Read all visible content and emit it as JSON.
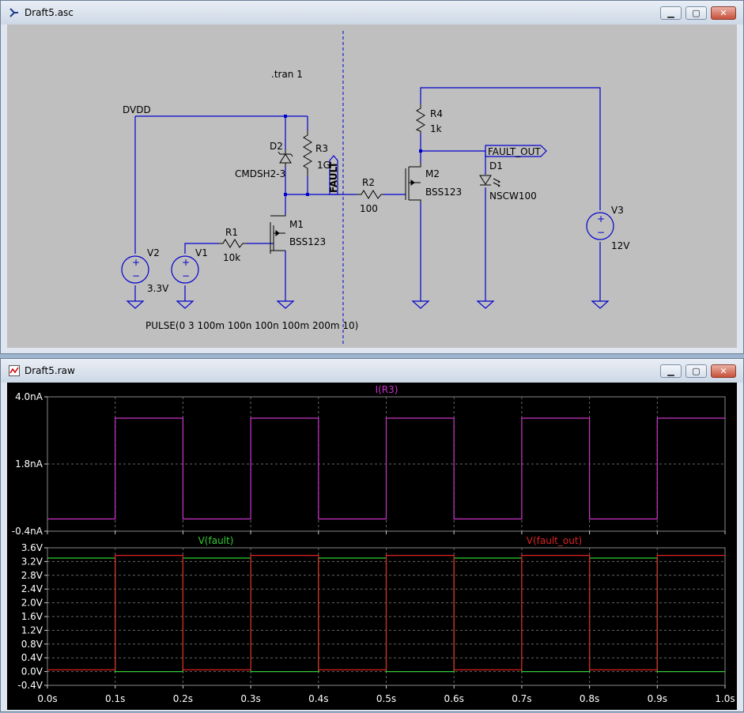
{
  "schematic_window": {
    "title": "Draft5.asc",
    "directive": ".tran 1",
    "net_dvdd": "DVDD",
    "net_fault": "FAULT",
    "net_fault_out": "FAULT_OUT",
    "pulse_spec": "PULSE(0 3 100m 100n 100n 100m 200m 10)",
    "components": {
      "D2": {
        "name": "D2",
        "value": "CMDSH2-3"
      },
      "R3": {
        "name": "R3",
        "value": "1G"
      },
      "R2": {
        "name": "R2",
        "value": "100"
      },
      "R4": {
        "name": "R4",
        "value": "1k"
      },
      "M2": {
        "name": "M2",
        "value": "BSS123"
      },
      "D1": {
        "name": "D1",
        "value": "NSCW100"
      },
      "M1": {
        "name": "M1",
        "value": "BSS123"
      },
      "R1": {
        "name": "R1",
        "value": "10k"
      },
      "V1": {
        "name": "V1",
        "value": ""
      },
      "V2": {
        "name": "V2",
        "value": "3.3V"
      },
      "V3": {
        "name": "V3",
        "value": "12V"
      }
    }
  },
  "waveform_window": {
    "title": "Draft5.raw",
    "x_ticks": [
      "0.0s",
      "0.1s",
      "0.2s",
      "0.3s",
      "0.4s",
      "0.5s",
      "0.6s",
      "0.7s",
      "0.8s",
      "0.9s",
      "1.0s"
    ],
    "top_pane": {
      "trace_label": "I(R3)",
      "y_ticks": [
        "4.0nA",
        "1.8nA",
        "-0.4nA"
      ]
    },
    "bottom_pane": {
      "trace1_label": "V(fault)",
      "trace2_label": "V(fault_out)",
      "y_ticks": [
        "3.6V",
        "3.2V",
        "2.8V",
        "2.4V",
        "2.0V",
        "1.6V",
        "1.2V",
        "0.8V",
        "0.4V",
        "0.0V",
        "-0.4V"
      ]
    }
  },
  "colors": {
    "schematic_bg": "#c0bfc0",
    "wire": "#0000cc",
    "plot_bg": "#000000",
    "i_r3": "#cc33cc",
    "v_fault": "#33cc33",
    "v_fault_out": "#dd2222"
  },
  "chart_data": [
    {
      "type": "line",
      "title": "I(R3)",
      "xlabel": "",
      "ylabel": "",
      "xlim": [
        0,
        1.0
      ],
      "ylim": [
        -0.4,
        4.0
      ],
      "grid": true,
      "series": [
        {
          "name": "I(R3)",
          "x": [
            0,
            0.1,
            0.1,
            0.2,
            0.2,
            0.3,
            0.3,
            0.4,
            0.4,
            0.5,
            0.5,
            0.6,
            0.6,
            0.7,
            0.7,
            0.8,
            0.8,
            0.9,
            0.9,
            1.0
          ],
          "y": [
            0,
            0,
            3.3,
            3.3,
            0,
            0,
            3.3,
            3.3,
            0,
            0,
            3.3,
            3.3,
            0,
            0,
            3.3,
            3.3,
            0,
            0,
            3.3,
            3.3
          ]
        }
      ]
    },
    {
      "type": "line",
      "xlabel": "",
      "ylabel": "",
      "xlim": [
        0,
        1.0
      ],
      "ylim": [
        -0.4,
        3.6
      ],
      "grid": true,
      "series": [
        {
          "name": "V(fault)",
          "x": [
            0,
            0.1,
            0.1,
            0.2,
            0.2,
            0.3,
            0.3,
            0.4,
            0.4,
            0.5,
            0.5,
            0.6,
            0.6,
            0.7,
            0.7,
            0.8,
            0.8,
            0.9,
            0.9,
            1.0
          ],
          "y": [
            3.3,
            3.3,
            0,
            0,
            3.3,
            3.3,
            0,
            0,
            3.3,
            3.3,
            0,
            0,
            3.3,
            3.3,
            0,
            0,
            3.3,
            3.3,
            0,
            0
          ]
        },
        {
          "name": "V(fault_out)",
          "x": [
            0,
            0.1,
            0.1,
            0.2,
            0.2,
            0.3,
            0.3,
            0.4,
            0.4,
            0.5,
            0.5,
            0.6,
            0.6,
            0.7,
            0.7,
            0.8,
            0.8,
            0.9,
            0.9,
            1.0
          ],
          "y": [
            0.05,
            0.05,
            3.38,
            3.38,
            0.05,
            0.05,
            3.38,
            3.38,
            0.05,
            0.05,
            3.38,
            3.38,
            0.05,
            0.05,
            3.38,
            3.38,
            0.05,
            0.05,
            3.38,
            3.38
          ]
        }
      ]
    }
  ]
}
